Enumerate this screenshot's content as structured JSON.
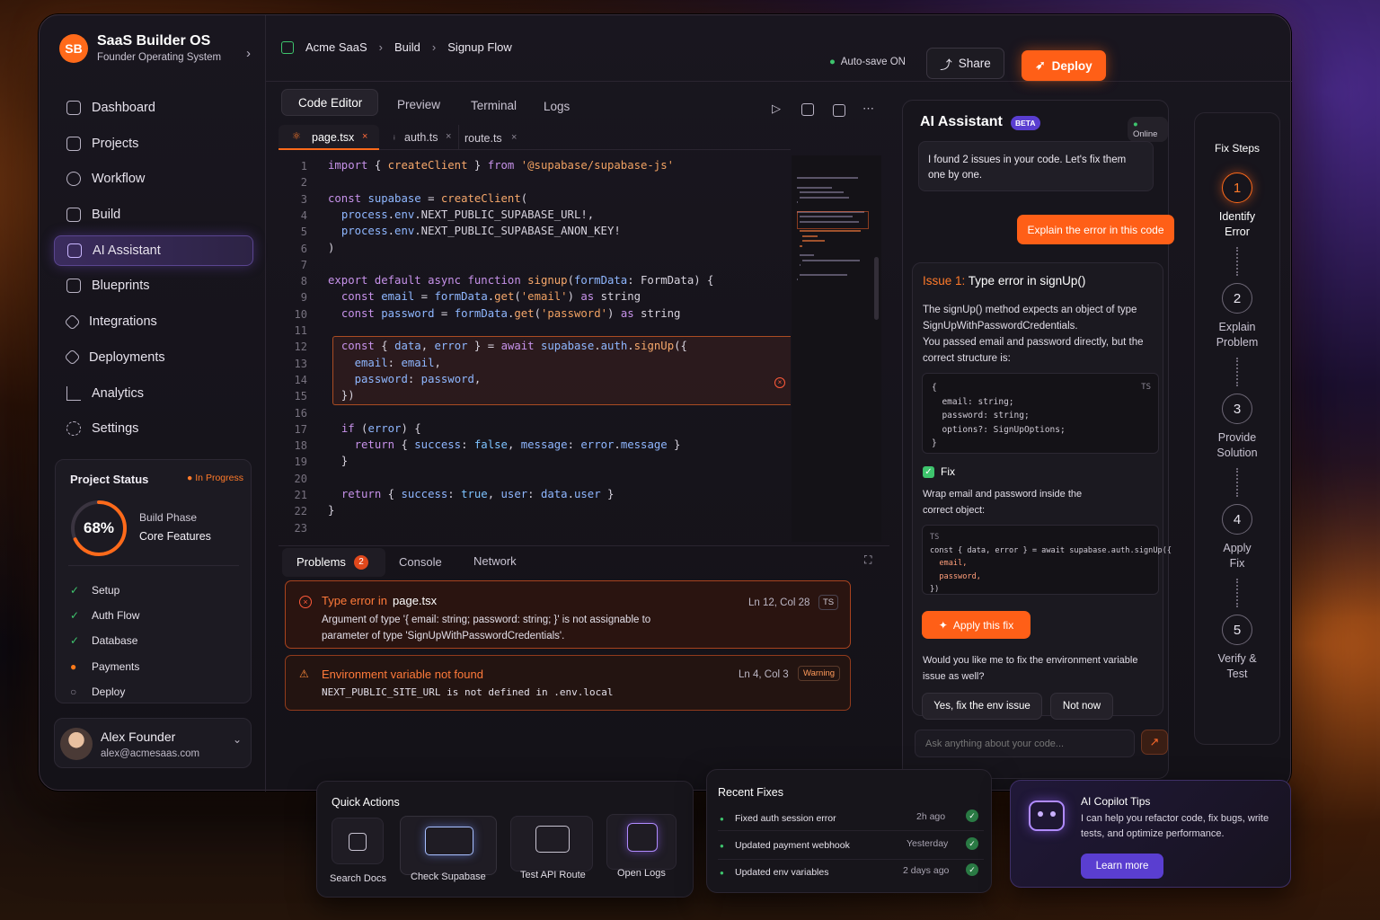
{
  "brand": {
    "logo": "SB",
    "title": "SaaS Builder OS",
    "subtitle": "Founder Operating System"
  },
  "nav": [
    {
      "label": "Dashboard",
      "icon": "dashboard-icon"
    },
    {
      "label": "Projects",
      "icon": "projects-icon"
    },
    {
      "label": "Workflow",
      "icon": "workflow-icon"
    },
    {
      "label": "Build",
      "icon": "build-icon"
    },
    {
      "label": "AI Assistant",
      "icon": "ai-assistant-icon",
      "active": true
    },
    {
      "label": "Blueprints",
      "icon": "blueprints-icon"
    },
    {
      "label": "Integrations",
      "icon": "integrations-icon"
    },
    {
      "label": "Deployments",
      "icon": "deployments-icon"
    },
    {
      "label": "Analytics",
      "icon": "analytics-icon"
    },
    {
      "label": "Settings",
      "icon": "settings-icon"
    }
  ],
  "project_status": {
    "title": "Project Status",
    "badge": "In Progress",
    "percent": "68%",
    "progress": 0.68,
    "phase_label": "Build Phase",
    "phase_value": "Core Features",
    "items": [
      {
        "label": "Setup",
        "state": "done"
      },
      {
        "label": "Auth Flow",
        "state": "done"
      },
      {
        "label": "Database",
        "state": "done"
      },
      {
        "label": "Payments",
        "state": "active"
      },
      {
        "label": "Deploy",
        "state": "pending"
      }
    ]
  },
  "user": {
    "name": "Alex Founder",
    "email": "alex@acmesaas.com"
  },
  "breadcrumb": [
    "Acme SaaS",
    "Build",
    "Signup Flow"
  ],
  "autosave": "Auto-save ON",
  "share_label": "Share",
  "deploy_label": "Deploy",
  "view_tabs": [
    "Code Editor",
    "Preview",
    "Terminal",
    "Logs"
  ],
  "file_tabs": [
    "page.tsx",
    "auth.ts",
    "route.ts"
  ],
  "code": [
    "import { createClient } from '@supabase/supabase-js'",
    "",
    "const supabase = createClient(",
    "  process.env.NEXT_PUBLIC_SUPABASE_URL!,",
    "  process.env.NEXT_PUBLIC_SUPABASE_ANON_KEY!",
    ")",
    "",
    "export default async function signup(formData: FormData) {",
    "  const email = formData.get('email') as string",
    "  const password = formData.get('password') as string",
    "",
    "  const { data, error } = await supabase.auth.signUp({",
    "    email: email,",
    "    password: password,",
    "  })",
    "",
    "  if (error) {",
    "    return { success: false, message: error.message }",
    "  }",
    "",
    "  return { success: true, user: data.user }",
    "}",
    ""
  ],
  "bottom_tabs": {
    "problems": "Problems",
    "problems_count": "2",
    "console": "Console",
    "network": "Network"
  },
  "problems": [
    {
      "title_prefix": "Type error in",
      "file": "page.tsx",
      "loc": "Ln 12, Col 28",
      "tag": "TS",
      "body": "Argument of type '{ email: string; password: string; }' is not assignable to parameter of type 'SignUpWithPasswordCredentials'."
    },
    {
      "title": "Environment variable not found",
      "loc": "Ln 4, Col 3",
      "tag": "Warning",
      "body": "NEXT_PUBLIC_SITE_URL is not defined in .env.local"
    }
  ],
  "ai": {
    "title": "AI Assistant",
    "beta": "BETA",
    "status": "Online",
    "message": "I found 2 issues in your code. Let's fix them one by one.",
    "user_prompt": "Explain the error in this code",
    "issue_label": "Issue 1:",
    "issue_title": "Type error in signUp()",
    "issue_desc1": "The signUp() method expects an object of type SignUpWithPasswordCredentials.",
    "issue_desc2": "You passed email and password directly, but the correct structure is:",
    "snippet1_tag": "TS",
    "snippet1": [
      "{",
      "  email: string;",
      "  password: string;",
      "  options?: SignUpOptions;",
      "}"
    ],
    "fix_label": "Fix",
    "fix_desc": "Wrap email and password inside the correct object:",
    "snippet2_tag": "TS",
    "snippet2": [
      "const { data, error } = await supabase.auth.signUp({",
      "  email,",
      "  password,",
      "})"
    ],
    "apply_label": "Apply this fix",
    "followup": "Would you like me to fix the environment variable issue as well?",
    "yes_label": "Yes, fix the env issue",
    "no_label": "Not now",
    "input_placeholder": "Ask anything about your code..."
  },
  "fix_steps": {
    "title": "Fix Steps",
    "steps": [
      {
        "n": "1",
        "label": "Identify Error"
      },
      {
        "n": "2",
        "label": "Explain Problem"
      },
      {
        "n": "3",
        "label": "Provide Solution"
      },
      {
        "n": "4",
        "label": "Apply Fix"
      },
      {
        "n": "5",
        "label": "Verify & Test"
      }
    ]
  },
  "quick_actions": {
    "title": "Quick Actions",
    "items": [
      "Search Docs",
      "Check Supabase",
      "Test API Route",
      "Open Logs"
    ]
  },
  "recent_fixes": {
    "title": "Recent Fixes",
    "items": [
      {
        "label": "Fixed auth session error",
        "time": "2h ago"
      },
      {
        "label": "Updated payment webhook",
        "time": "Yesterday"
      },
      {
        "label": "Updated env variables",
        "time": "2 days ago"
      }
    ]
  },
  "tips": {
    "title": "AI Copilot Tips",
    "body": "I can help you refactor code, fix bugs, write tests, and optimize performance.",
    "cta": "Learn more"
  },
  "colors": {
    "accent": "#ff6a1a",
    "purple": "#6c4ed8",
    "success": "#3ec46d",
    "error": "#ff5a3a"
  }
}
